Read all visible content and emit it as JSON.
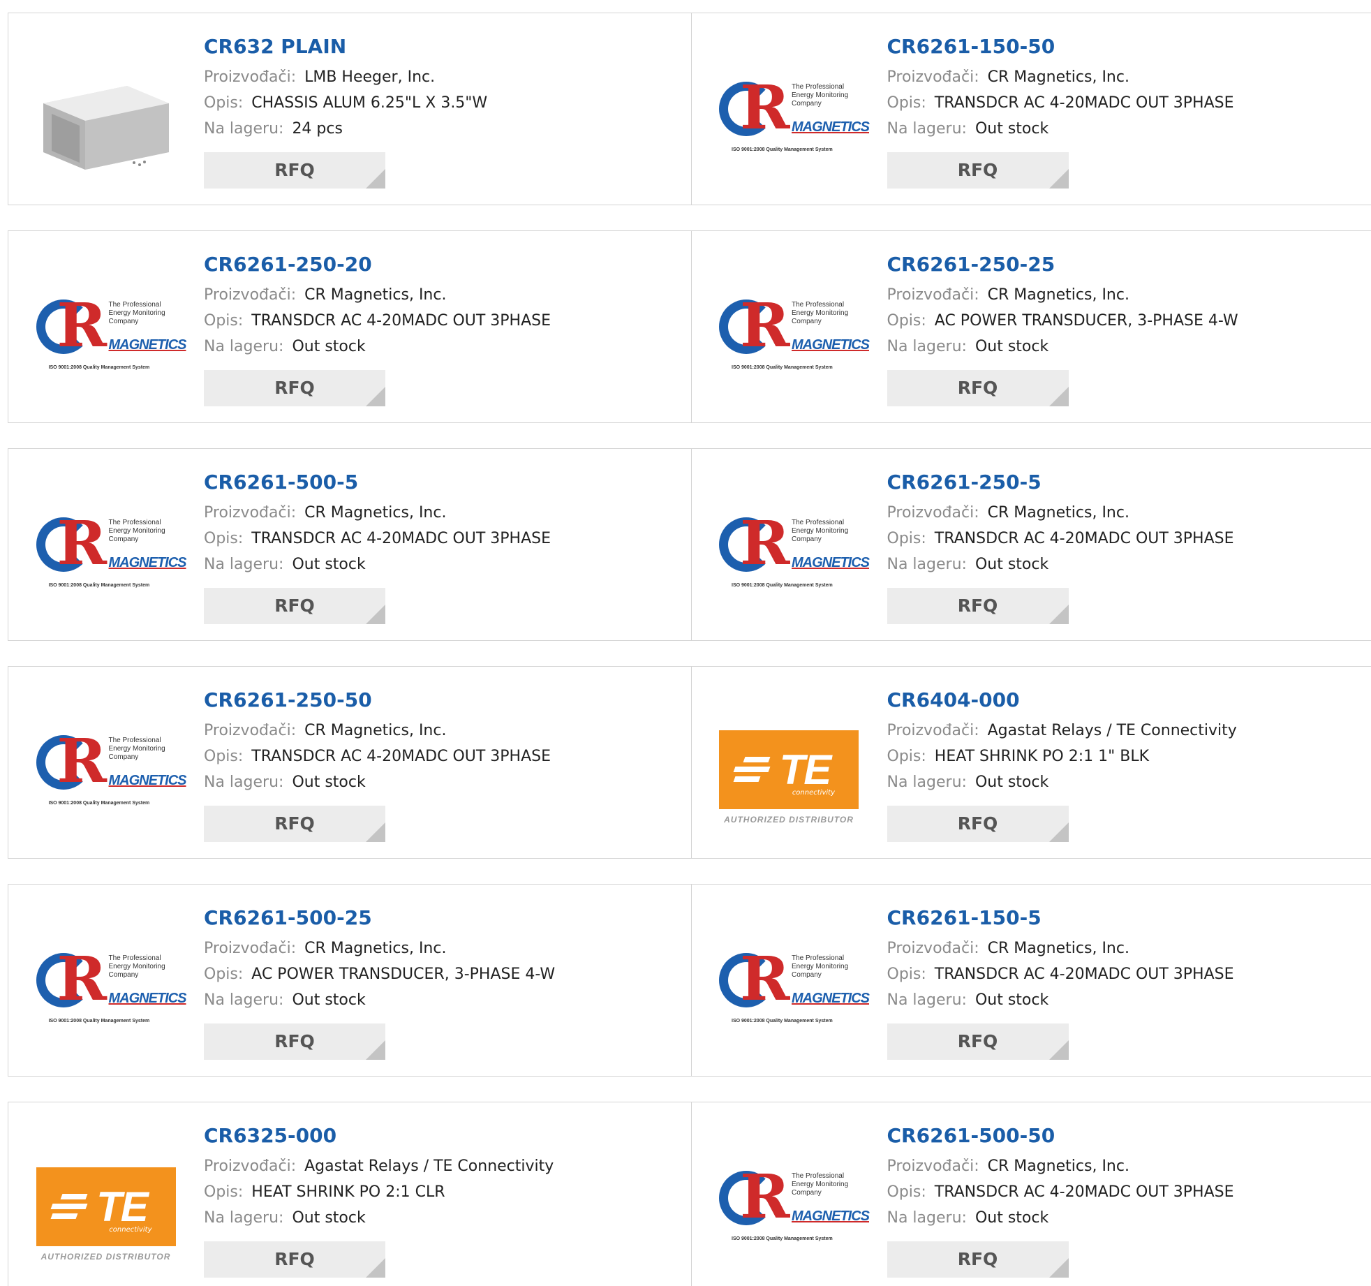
{
  "labels": {
    "manufacturer": "Proizvođači:",
    "description": "Opis:",
    "stock": "Na lageru:",
    "rfq": "RFQ"
  },
  "logo_text": {
    "cr_tagline": "The Professional Energy Monitoring Company",
    "cr_magnetics": "MAGNETICS",
    "cr_iso": "ISO 9001:2008 Quality Management System",
    "te_connectivity": "connectivity",
    "te_authorized": "AUTHORIZED DISTRIBUTOR"
  },
  "products": [
    {
      "part": "CR632 PLAIN",
      "manufacturer": "LMB Heeger, Inc.",
      "description": "CHASSIS ALUM 6.25\"L X 3.5\"W",
      "stock": "24 pcs",
      "image": "chassis-image"
    },
    {
      "part": "CR6261-150-50",
      "manufacturer": "CR Magnetics, Inc.",
      "description": "TRANSDCR AC 4-20MADC OUT 3PHASE",
      "stock": "Out stock",
      "image": "cr-magnetics-logo"
    },
    {
      "part": "CR6261-250-20",
      "manufacturer": "CR Magnetics, Inc.",
      "description": "TRANSDCR AC 4-20MADC OUT 3PHASE",
      "stock": "Out stock",
      "image": "cr-magnetics-logo"
    },
    {
      "part": "CR6261-250-25",
      "manufacturer": "CR Magnetics, Inc.",
      "description": "AC POWER TRANSDUCER, 3-PHASE 4-W",
      "stock": "Out stock",
      "image": "cr-magnetics-logo"
    },
    {
      "part": "CR6261-500-5",
      "manufacturer": "CR Magnetics, Inc.",
      "description": "TRANSDCR AC 4-20MADC OUT 3PHASE",
      "stock": "Out stock",
      "image": "cr-magnetics-logo"
    },
    {
      "part": "CR6261-250-5",
      "manufacturer": "CR Magnetics, Inc.",
      "description": "TRANSDCR AC 4-20MADC OUT 3PHASE",
      "stock": "Out stock",
      "image": "cr-magnetics-logo"
    },
    {
      "part": "CR6261-250-50",
      "manufacturer": "CR Magnetics, Inc.",
      "description": "TRANSDCR AC 4-20MADC OUT 3PHASE",
      "stock": "Out stock",
      "image": "cr-magnetics-logo"
    },
    {
      "part": "CR6404-000",
      "manufacturer": "Agastat Relays / TE Connectivity",
      "description": "HEAT SHRINK PO 2:1 1\" BLK",
      "stock": "Out stock",
      "image": "te-logo"
    },
    {
      "part": "CR6261-500-25",
      "manufacturer": "CR Magnetics, Inc.",
      "description": "AC POWER TRANSDUCER, 3-PHASE 4-W",
      "stock": "Out stock",
      "image": "cr-magnetics-logo"
    },
    {
      "part": "CR6261-150-5",
      "manufacturer": "CR Magnetics, Inc.",
      "description": "TRANSDCR AC 4-20MADC OUT 3PHASE",
      "stock": "Out stock",
      "image": "cr-magnetics-logo"
    },
    {
      "part": "CR6325-000",
      "manufacturer": "Agastat Relays / TE Connectivity",
      "description": "HEAT SHRINK PO 2:1 CLR",
      "stock": "Out stock",
      "image": "te-logo"
    },
    {
      "part": "CR6261-500-50",
      "manufacturer": "CR Magnetics, Inc.",
      "description": "TRANSDCR AC 4-20MADC OUT 3PHASE",
      "stock": "Out stock",
      "image": "cr-magnetics-logo"
    }
  ],
  "colors": {
    "title_link": "#1a5da8",
    "label_gray": "#8a8a8a",
    "button_bg": "#ececec",
    "te_orange": "#f3921d",
    "cr_blue": "#1d5fae",
    "cr_red": "#cf2a2a"
  }
}
